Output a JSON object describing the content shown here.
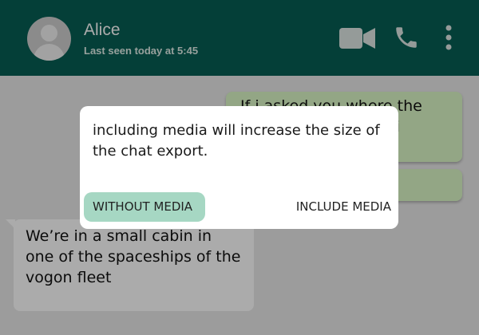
{
  "header": {
    "title": "Alice",
    "subtitle": "Last seen today at 5:45",
    "icons": [
      "avatar",
      "video-camera-icon",
      "phone-icon",
      "more-vertical-icon"
    ]
  },
  "chat": {
    "outgoing_1": "If i asked you where the\nhell we were, would i\nregret it?",
    "outgoing_2": "",
    "incoming_1": "We’re in a small cabin in one of the spaceships of the vogon fleet"
  },
  "dialog": {
    "message": "including media will increase the size of the chat export.",
    "without_label": "WITHOUT MEDIA",
    "include_label": "INCLUDE MEDIA"
  },
  "colors": {
    "header": "#075e54",
    "outgoing_bubble": "#dcf8c6",
    "incoming_bubble": "#ffffff",
    "primary_button": "#a6d7c3"
  }
}
